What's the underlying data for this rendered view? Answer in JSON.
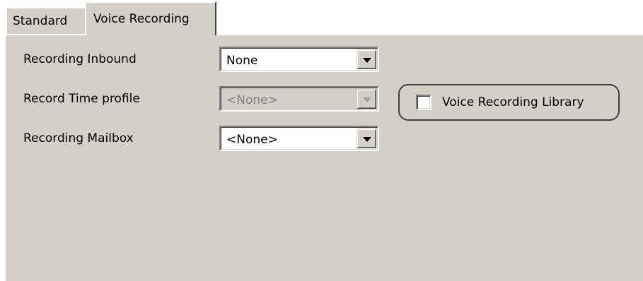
{
  "tabs": [
    {
      "label": "Standard",
      "selected": false
    },
    {
      "label": "Voice Recording",
      "selected": true
    }
  ],
  "form": {
    "recording_inbound": {
      "label": "Recording Inbound",
      "value": "None",
      "enabled": true
    },
    "record_time_profile": {
      "label": "Record Time profile",
      "value": "<None>",
      "enabled": false
    },
    "recording_mailbox": {
      "label": "Recording Mailbox",
      "value": "<None>",
      "enabled": true
    }
  },
  "voice_recording_library": {
    "label": "Voice Recording Library",
    "checked": false
  },
  "colors": {
    "panel_bg": "#d4d0c8",
    "disabled_text": "#808080"
  },
  "icons": {
    "dropdown": "chevron-down-icon",
    "checkbox": "checkbox-icon"
  }
}
